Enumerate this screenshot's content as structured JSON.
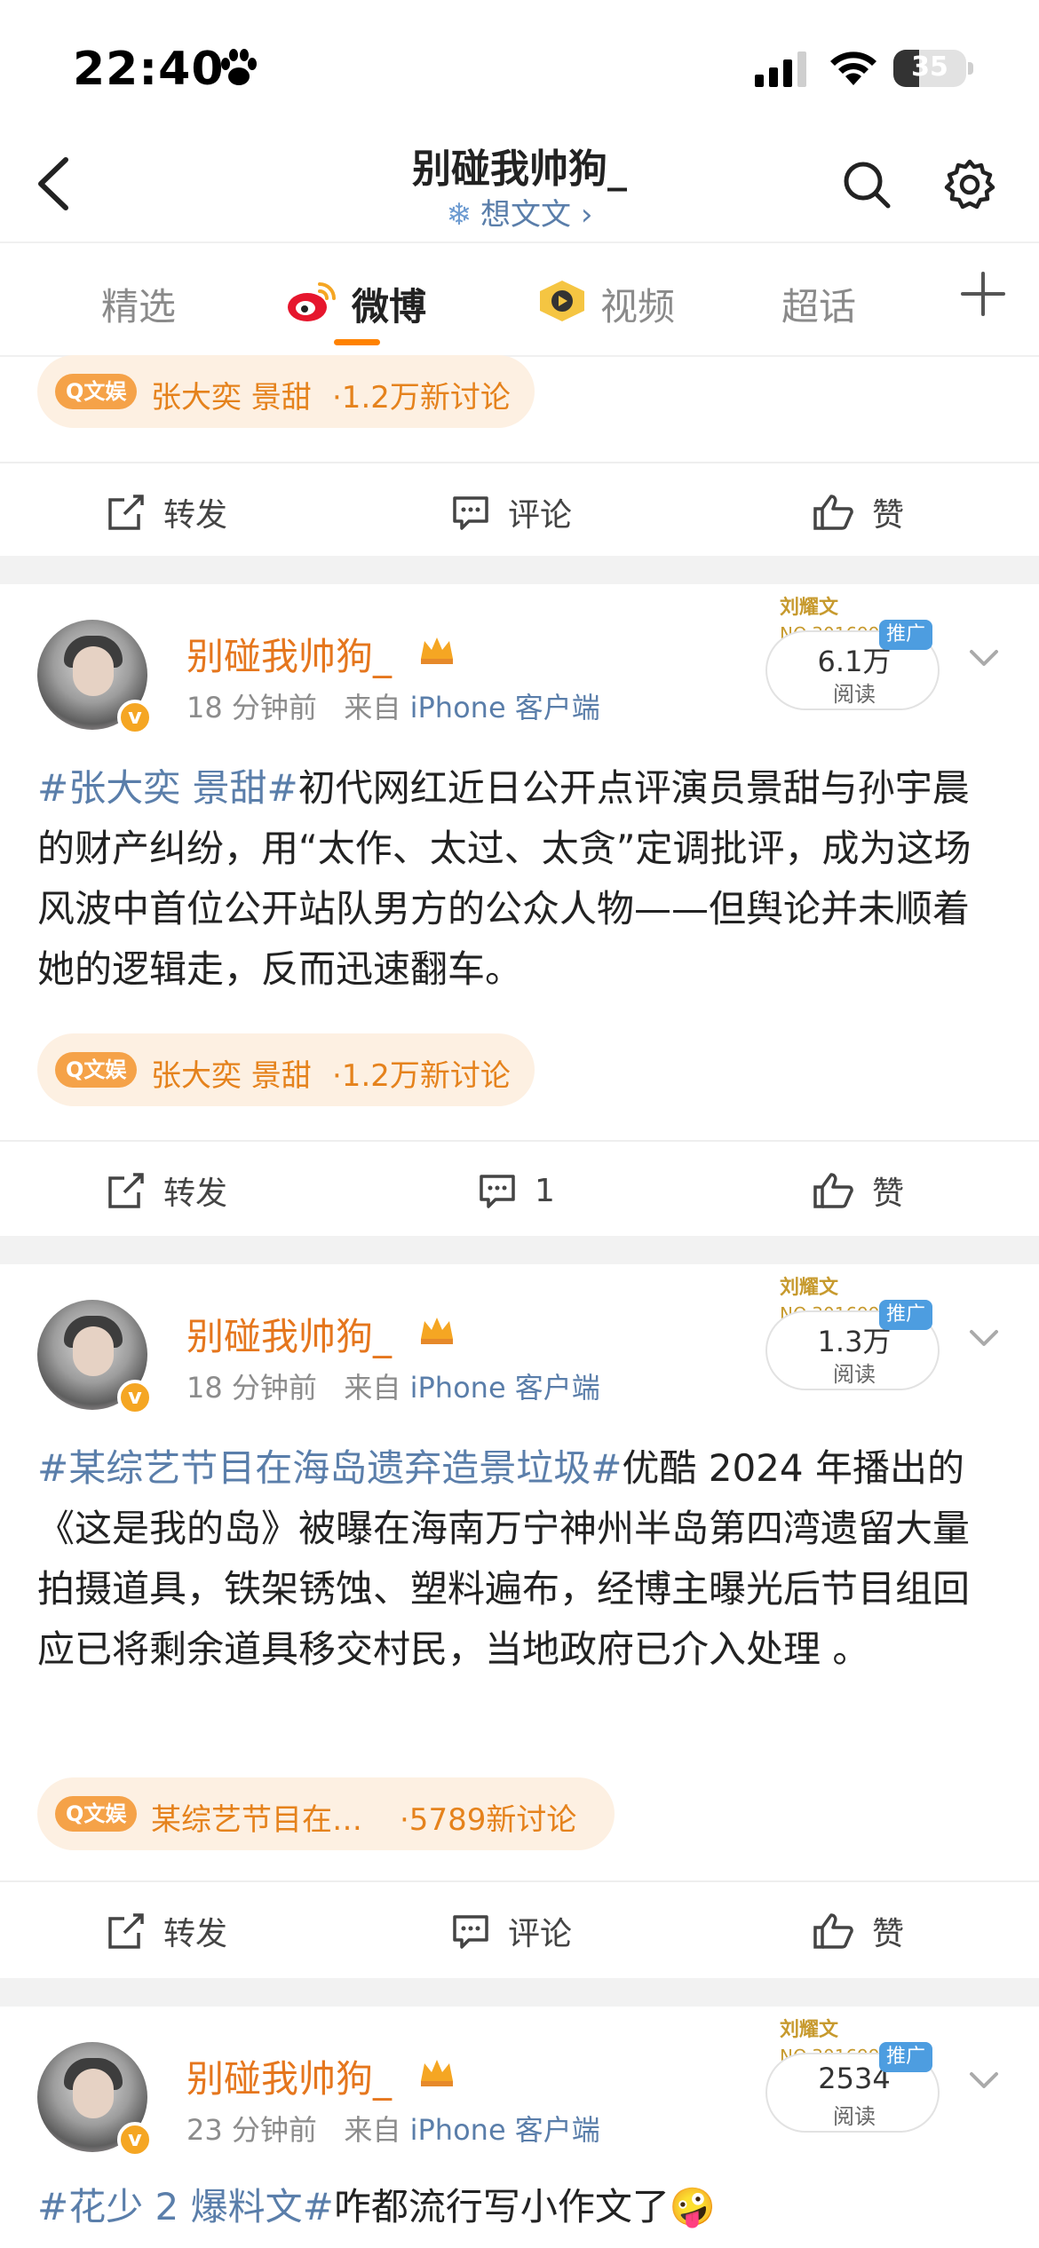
{
  "status_bar": {
    "time": "22:40",
    "battery": "35",
    "battery_level": 0.35
  },
  "header": {
    "title": "别碰我帅狗_",
    "subtitle": "想文文 ›"
  },
  "tabs": [
    {
      "label": "精选"
    },
    {
      "label": "微博"
    },
    {
      "label": "视频"
    },
    {
      "label": "超话"
    }
  ],
  "actions": {
    "repost": "转发",
    "comment": "评论",
    "like": "赞"
  },
  "topic_tag": "Q文娱",
  "top_post": {
    "topic": {
      "name": "张大奕 景甜",
      "count": "·1.2万新讨论"
    }
  },
  "posts": [
    {
      "username": "别碰我帅狗_",
      "time": "18 分钟前",
      "from_label": "来自",
      "source": "iPhone 客户端",
      "deco_name": "刘耀文",
      "deco_no": "NO.301699",
      "promo": "推广",
      "reads": "6.1万",
      "reads_label": "阅读",
      "hashtag": "#张大奕 景甜#",
      "text": "初代网红近日公开点评演员景甜与孙宇晨的财产纠纷，用“太作、太过、太贪”定调批评，成为这场风波中首位公开站队男方的公众人物——但舆论并未顺着她的逻辑走，反而迅速翻车。",
      "topic": {
        "name": "张大奕 景甜",
        "count": "·1.2万新讨论"
      },
      "comment_label": "1"
    },
    {
      "username": "别碰我帅狗_",
      "time": "18 分钟前",
      "from_label": "来自",
      "source": "iPhone 客户端",
      "deco_name": "刘耀文",
      "deco_no": "NO.301699",
      "promo": "推广",
      "reads": "1.3万",
      "reads_label": "阅读",
      "hashtag": "#某综艺节目在海岛遗弃造景垃圾#",
      "text": "优酷 2024 年播出的《这是我的岛》被曝在海南万宁神州半岛第四湾遗留大量拍摄道具，铁架锈蚀、塑料遍布，经博主曝光后节目组回应已将剩余道具移交村民，当地政府已介入处理 。",
      "topic": {
        "name": "某综艺节目在…",
        "count": "·5789新讨论"
      },
      "comment_label": "评论"
    },
    {
      "username": "别碰我帅狗_",
      "time": "23 分钟前",
      "from_label": "来自",
      "source": "iPhone 客户端",
      "deco_name": "刘耀文",
      "deco_no": "NO.301699",
      "promo": "推广",
      "reads": "2534",
      "reads_label": "阅读",
      "hashtag": "#花少 2 爆料文#",
      "text": "咋都流行写小作文了🤪"
    }
  ]
}
